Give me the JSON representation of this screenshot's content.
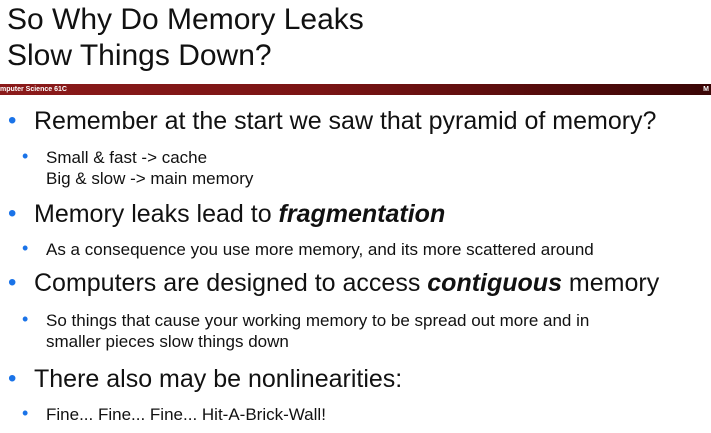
{
  "title": {
    "line1": "So Why Do Memory Leaks",
    "line2": "Slow Things Down?"
  },
  "header_bar": {
    "left_text": "mputer Science 61C",
    "right_text": "M"
  },
  "bullets": [
    {
      "text": "Remember at the start we saw that pyramid of memory?"
    },
    {
      "sub": [
        "Small & fast -> cache",
        "Big & slow -> main memory"
      ]
    },
    {
      "before": "Memory leaks lead to ",
      "emph": "fragmentation",
      "after": ""
    },
    {
      "sub": [
        "As a consequence you use more memory, and its more scattered around"
      ]
    },
    {
      "before": "Computers are designed to access ",
      "emph": "contiguous",
      "after": " memory"
    },
    {
      "sub": [
        "So things that cause your working memory to be spread out more and in",
        "smaller pieces slow things down"
      ]
    },
    {
      "text": "There also may be nonlinearities:"
    },
    {
      "sub": [
        "Fine... Fine... Fine... Hit-A-Brick-Wall!"
      ]
    }
  ],
  "colors": {
    "bullet": "#1a73e8",
    "bar": "#8b1a1a"
  }
}
